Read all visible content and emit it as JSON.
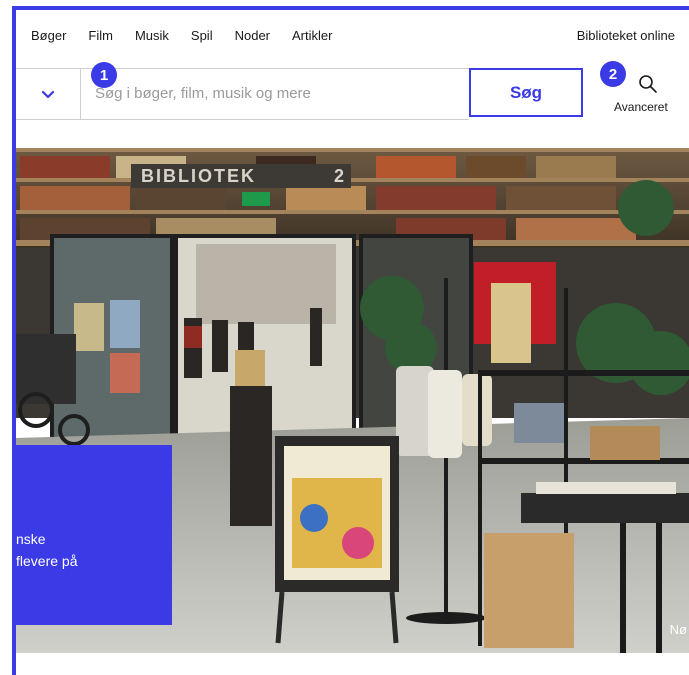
{
  "nav": {
    "links": [
      "Bøger",
      "Film",
      "Musik",
      "Spil",
      "Noder",
      "Artikler"
    ],
    "online": "Biblioteket online"
  },
  "search": {
    "placeholder": "Søg i bøger, film, musik og mere",
    "button": "Søg",
    "advanced": "Avanceret"
  },
  "badges": [
    "1",
    "2"
  ],
  "hero": {
    "sign_text": "BIBLIOTEK",
    "sign_number": "2",
    "promo_line1": "nske",
    "promo_line2": "flevere på",
    "corner_text": "Nø"
  },
  "colors": {
    "accent": "#3a3ae6"
  },
  "icons": {
    "dropdown": "chevron-down-icon",
    "advanced": "search-icon"
  }
}
